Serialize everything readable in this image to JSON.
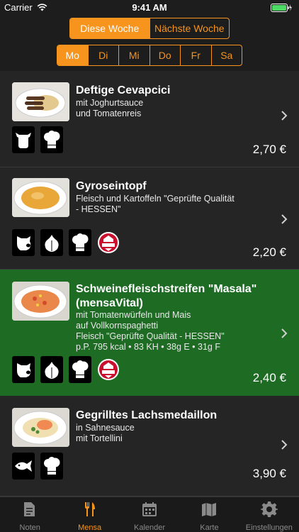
{
  "status_bar": {
    "carrier": "Carrier",
    "time": "9:41 AM"
  },
  "week_tabs": [
    {
      "label": "Diese Woche",
      "active": true
    },
    {
      "label": "Nächste Woche",
      "active": false
    }
  ],
  "day_tabs": [
    {
      "label": "Mo",
      "active": true
    },
    {
      "label": "Di",
      "active": false
    },
    {
      "label": "Mi",
      "active": false
    },
    {
      "label": "Do",
      "active": false
    },
    {
      "label": "Fr",
      "active": false
    },
    {
      "label": "Sa",
      "active": false
    }
  ],
  "meals": [
    {
      "title": "Deftige Cevapcici",
      "desc": [
        "mit Joghurtsauce",
        "und Tomatenreis"
      ],
      "price": "2,70 €",
      "icons": [
        "cow-icon",
        "chef-hat-icon"
      ]
    },
    {
      "title": "Gyroseintopf",
      "desc": [
        "",
        "Fleisch und Kartoffeln \"Geprüfte Qualität",
        "- HESSEN\""
      ],
      "price": "2,20 €",
      "icons": [
        "pig-icon",
        "garlic-icon",
        "chef-hat-icon",
        "quality-seal-icon"
      ]
    },
    {
      "title": "Schweinefleischstreifen \"Masala\" (mensaVital)",
      "desc": [
        "mit Tomatenwürfeln und Mais",
        "auf Vollkornspaghetti",
        "Fleisch \"Geprüfte Qualität - HESSEN\"",
        "p.P. 795 kcal • 83 KH • 38g E • 31g F"
      ],
      "price": "2,40 €",
      "icons": [
        "pig-icon",
        "garlic-icon",
        "chef-hat-icon",
        "quality-seal-icon"
      ]
    },
    {
      "title": "Gegrilltes Lachsmedaillon",
      "desc": [
        "in Sahnesauce",
        "mit Tortellini"
      ],
      "price": "3,90 €",
      "icons": [
        "fish-icon",
        "chef-hat-icon"
      ]
    }
  ],
  "tabs": [
    {
      "label": "Noten",
      "icon": "document-icon",
      "active": false
    },
    {
      "label": "Mensa",
      "icon": "fork-knife-icon",
      "active": true
    },
    {
      "label": "Kalender",
      "icon": "calendar-icon",
      "active": false
    },
    {
      "label": "Karte",
      "icon": "map-icon",
      "active": false
    },
    {
      "label": "Einstellungen",
      "icon": "gear-icon",
      "active": false
    }
  ],
  "colors": {
    "accent": "#f7941d",
    "highlight": "#1e6b24",
    "background": "#252525"
  }
}
